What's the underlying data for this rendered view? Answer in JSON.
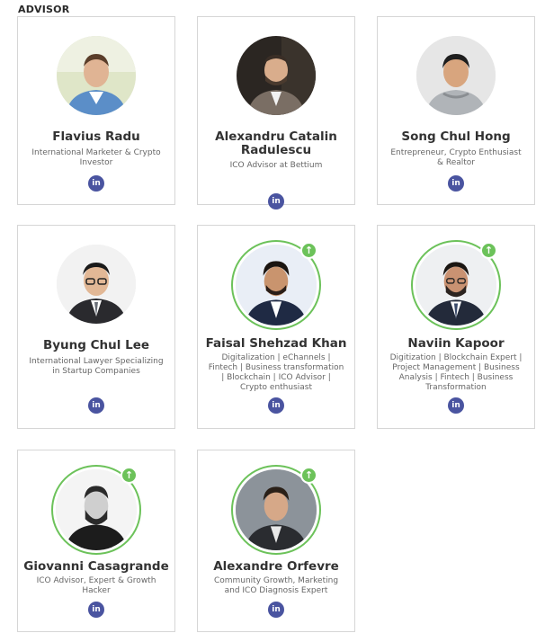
{
  "section": {
    "title": "ADVISOR"
  },
  "advisors": [
    {
      "name": "Flavius Radu",
      "title": "International Marketer & Crypto Investor",
      "social": "in",
      "verified": false
    },
    {
      "name": "Alexandru Catalin Radulescu",
      "title": "ICO Advisor at Bettium",
      "social": "in",
      "verified": false
    },
    {
      "name": "Song Chul Hong",
      "title": "Entrepreneur, Crypto Enthusiast & Realtor",
      "social": "in",
      "verified": false
    },
    {
      "name": "Byung Chul Lee",
      "title": "International Lawyer Specializing in Startup Companies",
      "social": "in",
      "verified": false
    },
    {
      "name": "Faisal Shehzad Khan",
      "title": "Digitalization | eChannels | Fintech | Business transformation | Blockchain | ICO Advisor | Crypto enthusiast",
      "social": "in",
      "verified": true
    },
    {
      "name": "Naviin Kapoor",
      "title": "Digitization | Blockchain Expert | Project Management | Business Analysis | Fintech | Business Transformation",
      "social": "in",
      "verified": true
    },
    {
      "name": "Giovanni Casagrande",
      "title": "ICO Advisor, Expert & Growth Hacker",
      "social": "in",
      "verified": true
    },
    {
      "name": "Alexandre Orfevre",
      "title": "Community Growth, Marketing and ICO Diagnosis Expert",
      "social": "in",
      "verified": true
    }
  ],
  "icons": {
    "social": "linkedin-icon",
    "badge": "arrow-up-icon",
    "badge_glyph": "↑"
  },
  "colors": {
    "badge": "#6cc25a",
    "linkedin": "#4a54a0",
    "name": "#333333",
    "title": "#666666",
    "border": "#d6d6d6"
  }
}
